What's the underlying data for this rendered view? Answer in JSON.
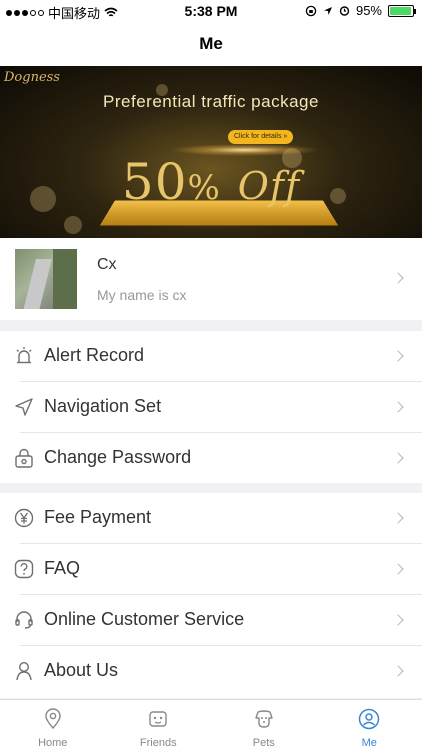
{
  "status_bar": {
    "carrier": "中国移动",
    "time": "5:38 PM",
    "battery_percent": "95%",
    "battery_level": 0.95,
    "battery_color": "#4cd964"
  },
  "nav": {
    "title": "Me"
  },
  "banner": {
    "brand": "Dogness",
    "title": "Preferential traffic package",
    "detail_button": "Click for details",
    "offer_number": "50",
    "offer_percent": "%",
    "offer_word": "Off"
  },
  "profile": {
    "name": "Cx",
    "signature": "My name is cx"
  },
  "menu_group_1": [
    {
      "label": "Alert Record",
      "icon": "alarm-light-icon"
    },
    {
      "label": "Navigation Set",
      "icon": "navigation-arrow-icon"
    },
    {
      "label": "Change Password",
      "icon": "lock-icon"
    }
  ],
  "menu_group_2": [
    {
      "label": "Fee Payment",
      "icon": "yen-icon"
    },
    {
      "label": "FAQ",
      "icon": "question-icon"
    },
    {
      "label": "Online Customer Service",
      "icon": "headset-icon"
    },
    {
      "label": "About Us",
      "icon": "person-icon"
    }
  ],
  "tabs": [
    {
      "label": "Home",
      "icon": "location-pin-icon"
    },
    {
      "label": "Friends",
      "icon": "friends-icon"
    },
    {
      "label": "Pets",
      "icon": "dog-icon"
    },
    {
      "label": "Me",
      "icon": "user-icon",
      "active": true
    }
  ],
  "colors": {
    "accent": "#3a86d6",
    "icon_gray": "#6f6f6f",
    "chevron": "#b5b5b5",
    "background": "#f0f0f5"
  }
}
